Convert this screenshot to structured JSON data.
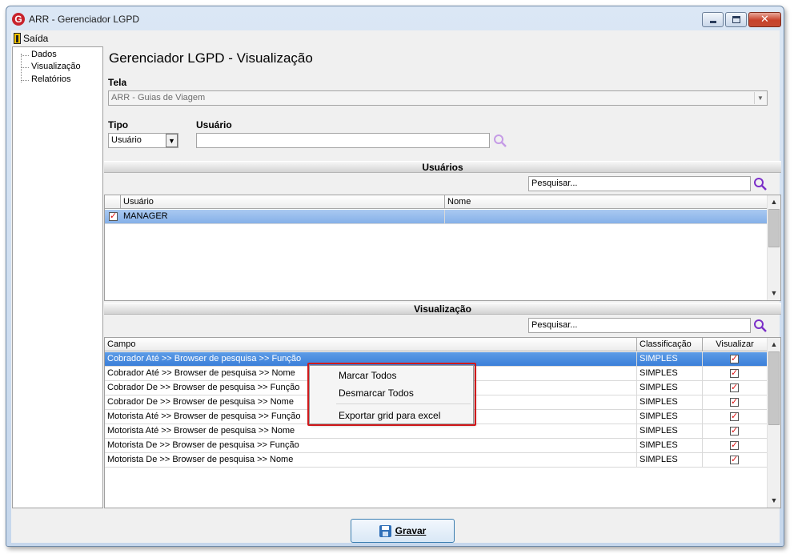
{
  "window": {
    "title": "ARR - Gerenciador LGPD",
    "app_icon": "G"
  },
  "menu": {
    "exit_label": "Saída"
  },
  "tree": {
    "items": [
      "Dados",
      "Visualização",
      "Relatórios"
    ]
  },
  "page": {
    "heading": "Gerenciador LGPD - Visualização"
  },
  "tela": {
    "label": "Tela",
    "value": "ARR - Guias de Viagem"
  },
  "tipo": {
    "label": "Tipo",
    "value": "Usuário"
  },
  "usuario_filter": {
    "label": "Usuário",
    "value": ""
  },
  "usuarios_section": {
    "title": "Usuários",
    "search_placeholder": "Pesquisar...",
    "columns": [
      "Usuário",
      "Nome"
    ],
    "rows": [
      {
        "usuario": "MANAGER",
        "nome": "",
        "checked": true
      }
    ]
  },
  "visualizacao_section": {
    "title": "Visualização",
    "search_placeholder": "Pesquisar...",
    "columns": [
      "Campo",
      "Classificação",
      "Visualizar"
    ],
    "rows": [
      {
        "campo": "Cobrador Até >> Browser de pesquisa >> Função",
        "classificacao": "SIMPLES",
        "visualizar": true
      },
      {
        "campo": "Cobrador Até >> Browser de pesquisa >> Nome",
        "classificacao": "SIMPLES",
        "visualizar": true
      },
      {
        "campo": "Cobrador De >> Browser de pesquisa >> Função",
        "classificacao": "SIMPLES",
        "visualizar": true
      },
      {
        "campo": "Cobrador De >> Browser de pesquisa >> Nome",
        "classificacao": "SIMPLES",
        "visualizar": true
      },
      {
        "campo": "Motorista Até >> Browser de pesquisa >> Função",
        "classificacao": "SIMPLES",
        "visualizar": true
      },
      {
        "campo": "Motorista Até >> Browser de pesquisa >> Nome",
        "classificacao": "SIMPLES",
        "visualizar": true
      },
      {
        "campo": "Motorista De >> Browser de pesquisa >> Função",
        "classificacao": "SIMPLES",
        "visualizar": true
      },
      {
        "campo": "Motorista De >> Browser de pesquisa >> Nome",
        "classificacao": "SIMPLES",
        "visualizar": true
      }
    ]
  },
  "context_menu": {
    "items": [
      "Marcar Todos",
      "Desmarcar Todos",
      "Exportar grid para excel"
    ]
  },
  "footer": {
    "save_label": "Gravar"
  },
  "colors": {
    "selection": "#3b7fd9",
    "highlight_border": "#d0181b",
    "search_icon": "#7b2fc8",
    "checkmark": "#dd1111"
  }
}
